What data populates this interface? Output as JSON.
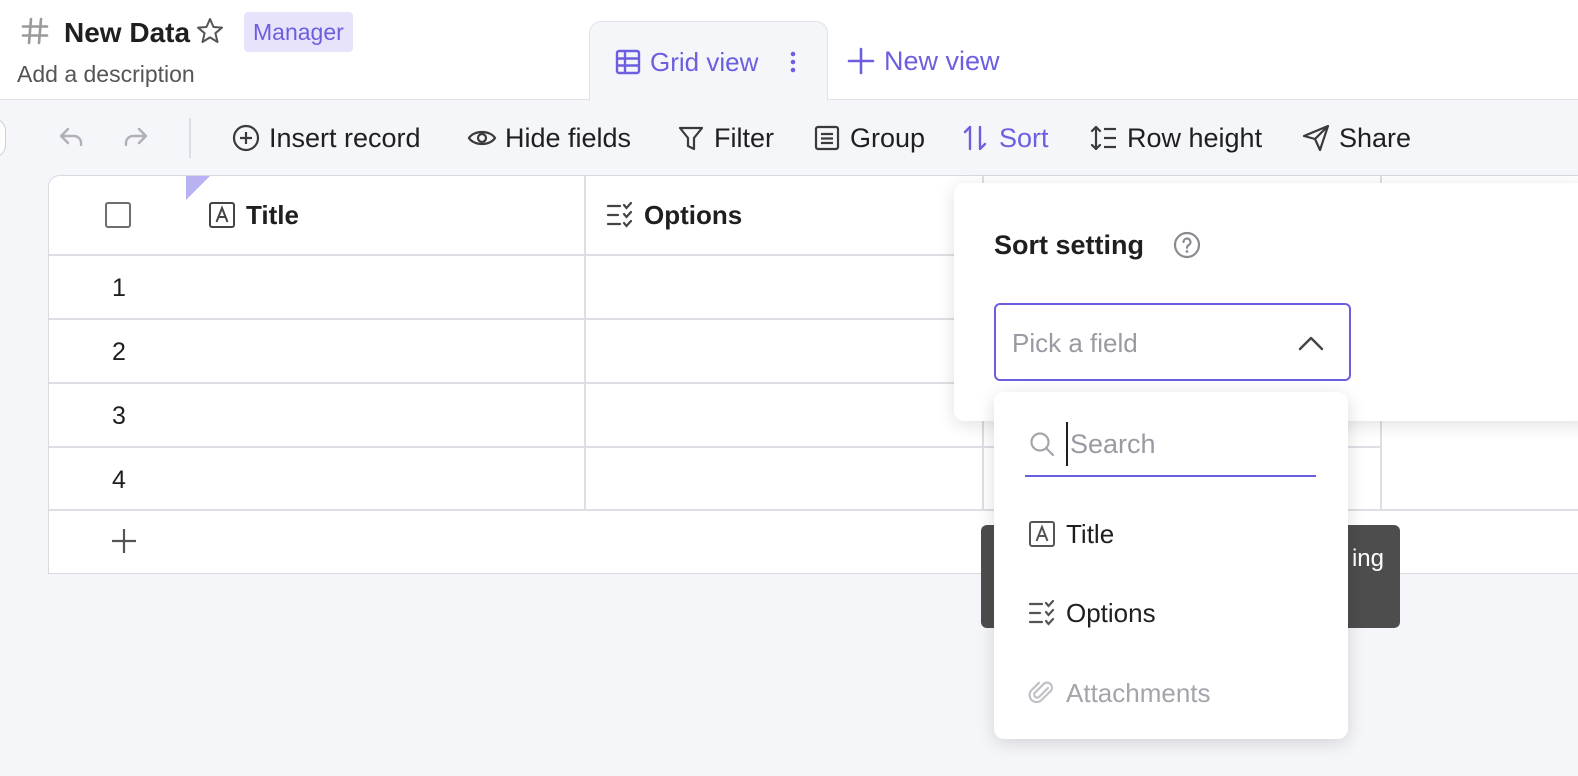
{
  "header": {
    "title": "New Data",
    "role_badge": "Manager",
    "description": "Add a description",
    "active_view": "Grid view",
    "new_view": "New view"
  },
  "toolbar": {
    "insert_record": "Insert record",
    "hide_fields": "Hide fields",
    "filter": "Filter",
    "group": "Group",
    "sort": "Sort",
    "row_height": "Row height",
    "share": "Share"
  },
  "grid": {
    "columns": [
      {
        "label": "Title",
        "icon": "text-field-icon"
      },
      {
        "label": "Options",
        "icon": "checklist-icon"
      }
    ],
    "rows": [
      "1",
      "2",
      "3",
      "4"
    ]
  },
  "toast": {
    "text_fragment": "ing"
  },
  "sort_panel": {
    "title": "Sort setting",
    "field_placeholder": "Pick a field",
    "search_placeholder": "Search",
    "fields": [
      {
        "label": "Title",
        "icon": "text-field-icon",
        "enabled": true
      },
      {
        "label": "Options",
        "icon": "checklist-icon",
        "enabled": true
      },
      {
        "label": "Attachments",
        "icon": "paperclip-icon",
        "enabled": false
      }
    ]
  },
  "colors": {
    "accent": "#6b5fe0",
    "badge_bg": "#e6e3fb",
    "background": "#f5f6fa"
  }
}
